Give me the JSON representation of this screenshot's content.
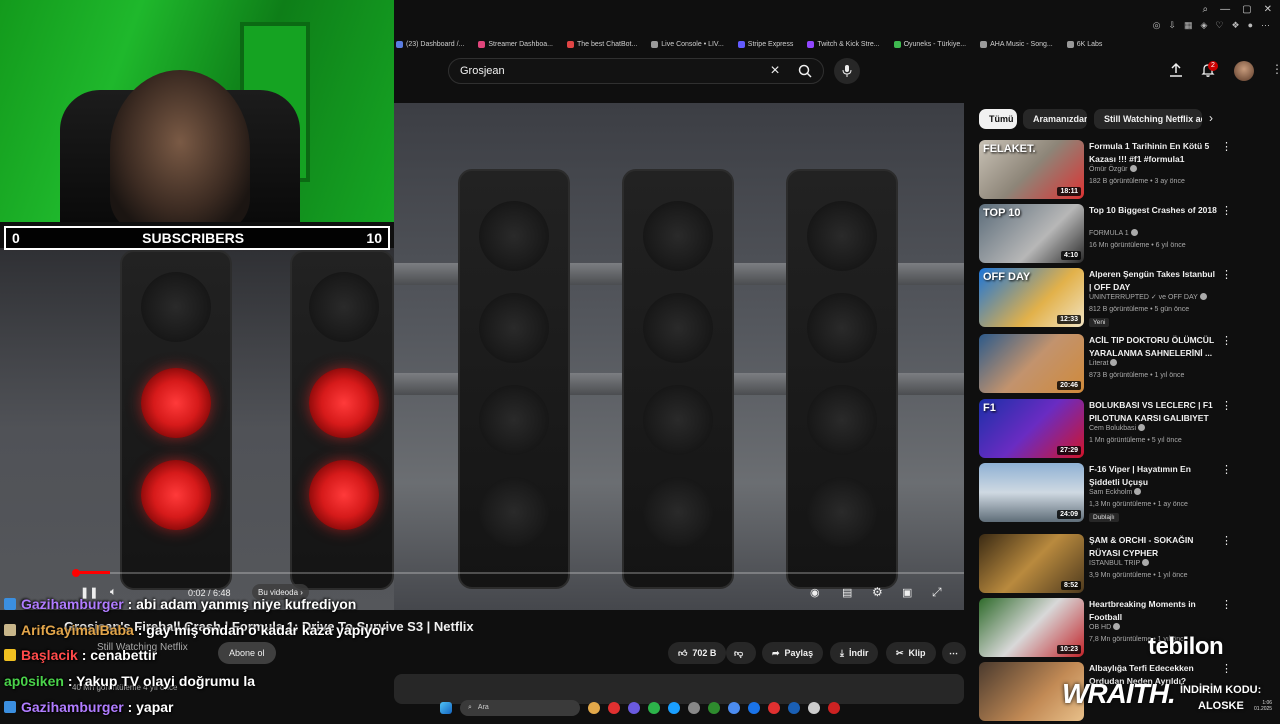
{
  "browser": {
    "bookmarks": [
      {
        "label": "(23) Dashboard /...",
        "color": "#5a7de0"
      },
      {
        "label": "Streamer Dashboa...",
        "color": "#e0457b"
      },
      {
        "label": "The best ChatBot...",
        "color": "#e04545"
      },
      {
        "label": "Live Console • LIV...",
        "color": "#999999"
      },
      {
        "label": "Stripe Express",
        "color": "#635bff"
      },
      {
        "label": "Twitch & Kick Stre...",
        "color": "#9146ff"
      },
      {
        "label": "Oyuneks - Türkiye...",
        "color": "#3fb950"
      },
      {
        "label": "AHA Music - Song...",
        "color": "#999999"
      },
      {
        "label": "6K Labs",
        "color": "#999999"
      }
    ]
  },
  "masthead": {
    "search_value": "Grosjean",
    "notification_count": "2"
  },
  "webcam": {
    "subs_left": "0",
    "subs_label": "SUBSCRIBERS",
    "subs_right": "10"
  },
  "player": {
    "time": "0:02 / 6:48",
    "chapter": "Bu videoda"
  },
  "chat": [
    {
      "user": "Gazihamburger",
      "message": " : abi adam yanmış niye kufrediyon",
      "user_color": "#b07cff",
      "icon_color": "#3b8fe0"
    },
    {
      "user": "ArifGayimalBaba",
      "message": " : gay miş ondan o kadar kaza yapıyor",
      "user_color": "#e2a54a",
      "icon_color": "#c8b68a"
    },
    {
      "user": "Başlacik",
      "message": " : cenabettir",
      "user_color": "#ff4a4a",
      "icon_color": "#f0c020"
    },
    {
      "user": "ap0siken",
      "message": " : Yakup TV olayi doğrumu la",
      "user_color": "#4ad24a",
      "icon_color": ""
    },
    {
      "user": "Gazihamburger",
      "message": " : yapar",
      "user_color": "#b07cff",
      "icon_color": "#3b8fe0"
    }
  ],
  "video": {
    "title": "Grosjean's Fireball Crash | Formula 1: Drive To Survive S3 | Netflix",
    "channel": "Still Watching Netflix",
    "subscribers": "40 Mn görüntüleme  4 yıl önce",
    "subscribe_label": "Abone ol",
    "like_count": "702 B",
    "share_label": "Paylaş",
    "download_label": "İndir",
    "clip_label": "Klip"
  },
  "chips": [
    {
      "label": "Tümü",
      "active": true
    },
    {
      "label": "Aramanızdan",
      "active": false
    },
    {
      "label": "Still Watching Netflix adlı",
      "active": false
    }
  ],
  "recommendations": [
    {
      "title": "Formula 1 Tarihinin En Kötü 5 Kazası !!! #f1 #formula1",
      "channel": "Ömür Özgür",
      "meta": "182 B görüntüleme • 3 ay önce",
      "duration": "18:11",
      "badge": "",
      "thumb": "linear-gradient(135deg,#c9c2b6 0%,#8d8578 50%,#d33 100%)",
      "thumb_text": "FELAKET."
    },
    {
      "title": "Top 10 Biggest Crashes of 2018",
      "channel": "FORMULA 1",
      "meta": "16 Mn görüntüleme • 6 yıl önce",
      "duration": "4:10",
      "badge": "",
      "thumb": "linear-gradient(135deg,#5b6c7a 0%,#b7b7b7 60%,#2a2a2a 100%)",
      "thumb_text": "TOP 10"
    },
    {
      "title": "Alperen Şengün Takes Istanbul | OFF DAY",
      "channel": "UNINTERRUPTED ✓ ve OFF DAY",
      "meta": "812 B görüntüleme • 5 gün önce",
      "duration": "12:33",
      "badge": "Yeni",
      "thumb": "linear-gradient(135deg,#1b74d8 0%,#e2b14a 60%,#f1e3c2 100%)",
      "thumb_text": "OFF DAY"
    },
    {
      "title": "ACİL TIP DOKTORU ÖLÜMCÜL YARALANMA SAHNELERİNİ ...",
      "channel": "Literat",
      "meta": "873 B görüntüleme • 1 yıl önce",
      "duration": "20:46",
      "badge": "",
      "thumb": "linear-gradient(135deg,#2d5a8a 0%,#c2936e 50%,#d08a3a 100%)",
      "thumb_text": ""
    },
    {
      "title": "BOLUKBASI VS LECLERC | F1 PILOTUNA KARSI GALIBIYET",
      "channel": "Cem Bolukbasi",
      "meta": "1 Mn görüntüleme • 5 yıl önce",
      "duration": "27:29",
      "badge": "",
      "thumb": "linear-gradient(135deg,#1c2fa8 0%,#6a2cc2 50%,#d1142a 100%)",
      "thumb_text": "F1"
    },
    {
      "title": "F-16 Viper | Hayatımın En Şiddetli Uçuşu",
      "channel": "Sam Eckholm",
      "meta": "1,3 Mn görüntüleme • 1 ay önce",
      "duration": "24:09",
      "badge": "Dublajlı",
      "thumb": "linear-gradient(180deg,#8fb1d4 0%,#cfd9e2 50%,#5f6d78 100%)",
      "thumb_text": ""
    },
    {
      "title": "ŞAM & ORCHI - SOKAĞIN RÜYASI CYPHER",
      "channel": "ISTANBUL TRIP",
      "meta": "3,9 Mn görüntüleme • 1 yıl önce",
      "duration": "8:52",
      "badge": "",
      "thumb": "linear-gradient(135deg,#3a2a14 0%,#b98a3e 50%,#4e3a1e 100%)",
      "thumb_text": ""
    },
    {
      "title": "Heartbreaking Moments in Football",
      "channel": "OB HD",
      "meta": "7,8 Mn görüntüleme • 1 yıl önce",
      "duration": "10:23",
      "badge": "",
      "thumb": "linear-gradient(135deg,#2f6b2b 0%,#d8d8d8 50%,#c2242a 100%)",
      "thumb_text": ""
    },
    {
      "title": "Albaylığa Terfi Edecekken Ordudan Neden Ayrıldı?",
      "channel": "",
      "meta": "",
      "duration": "",
      "badge": "",
      "thumb": "linear-gradient(135deg,#4a3a2e 0%,#c28a55 60%,#e8c08a 100%)",
      "thumb_text": ""
    }
  ],
  "overlays": {
    "sponsor_brand": "tebilon",
    "sponsor_brand_2": "WRAITH.",
    "discount_label": "İNDİRİM KODU:",
    "discount_code": "ALOSKE"
  },
  "taskbar": {
    "search_placeholder": "Ara",
    "clock_time": "1:06",
    "clock_date": "01.2025",
    "icon_colors": [
      "#e2a84a",
      "#e03030",
      "#6a5ae0",
      "#2cb34a",
      "#1a9fff",
      "#888888",
      "#2e8b2e",
      "#4c8cf0",
      "#1a73e8",
      "#e03030",
      "#1a5fb4",
      "#cccccc",
      "#cc2222"
    ]
  }
}
